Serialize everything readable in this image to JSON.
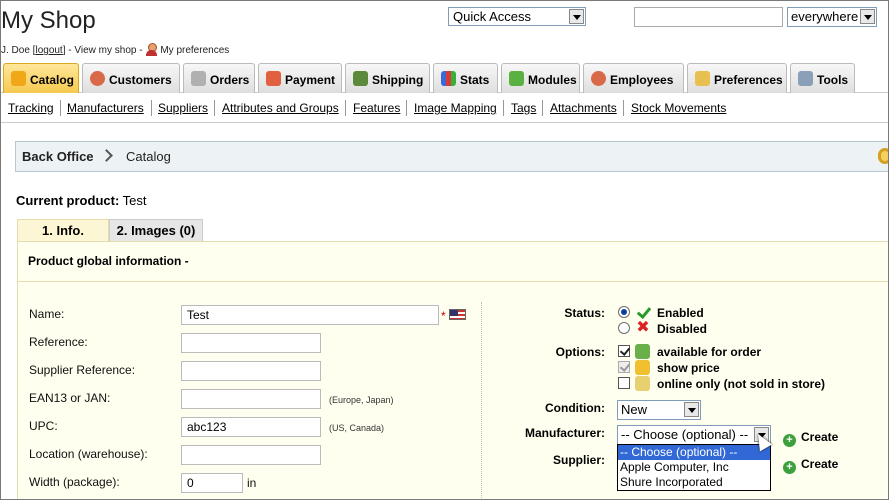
{
  "header": {
    "shop_title": "My Shop",
    "user_name": "J. Doe [",
    "logout": "logout",
    "after_logout": "] - View my shop -",
    "preferences": "My preferences",
    "quick_access": "Quick Access",
    "search_scope": "everywhere"
  },
  "tabs": [
    {
      "label": "Catalog",
      "icon": "folder-icon",
      "active": true
    },
    {
      "label": "Customers",
      "icon": "person-icon"
    },
    {
      "label": "Orders",
      "icon": "cart-icon"
    },
    {
      "label": "Payment",
      "icon": "payment-icon"
    },
    {
      "label": "Shipping",
      "icon": "truck-icon"
    },
    {
      "label": "Stats",
      "icon": "chart-icon"
    },
    {
      "label": "Modules",
      "icon": "puzzle-icon"
    },
    {
      "label": "Employees",
      "icon": "person-icon"
    },
    {
      "label": "Preferences",
      "icon": "preferences-icon"
    },
    {
      "label": "Tools",
      "icon": "wrench-icon"
    }
  ],
  "subnav": [
    "Tracking",
    "Manufacturers",
    "Suppliers",
    "Attributes and Groups",
    "Features",
    "Image Mapping",
    "Tags",
    "Attachments",
    "Stock Movements"
  ],
  "breadcrumb": {
    "root": "Back Office",
    "current": "Catalog"
  },
  "product": {
    "label": "Current product:",
    "name": "Test"
  },
  "product_tabs": [
    "1. Info.",
    "2. Images (0)"
  ],
  "panel_title": "Product global information -",
  "left_fields": {
    "name": {
      "label": "Name:",
      "value": "Test"
    },
    "reference": {
      "label": "Reference:",
      "value": ""
    },
    "supplier_reference": {
      "label": "Supplier Reference:",
      "value": ""
    },
    "ean13": {
      "label": "EAN13 or JAN:",
      "value": "",
      "hint": "(Europe, Japan)"
    },
    "upc": {
      "label": "UPC:",
      "value": "abc123",
      "hint": "(US, Canada)"
    },
    "location": {
      "label": "Location (warehouse):",
      "value": ""
    },
    "width": {
      "label": "Width (package):",
      "value": "0",
      "unit": "in"
    },
    "required_mark": "*"
  },
  "right_fields": {
    "status_label": "Status:",
    "enabled": "Enabled",
    "disabled": "Disabled",
    "options_label": "Options:",
    "available_for_order": "available for order",
    "show_price": "show price",
    "online_only": "online only (not sold in store)",
    "condition_label": "Condition:",
    "condition_value": "New",
    "manufacturer_label": "Manufacturer:",
    "manufacturer_value": "-- Choose (optional) --",
    "manufacturer_options": [
      "-- Choose (optional) --",
      "Apple Computer, Inc",
      "Shure Incorporated"
    ],
    "supplier_label": "Supplier:",
    "create": "Create"
  }
}
